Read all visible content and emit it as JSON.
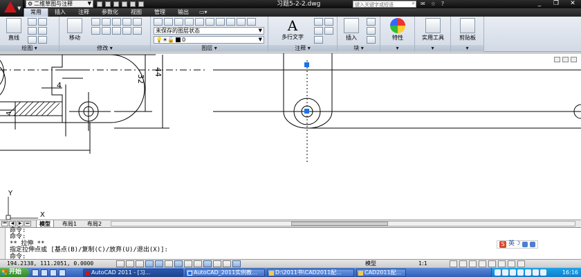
{
  "window": {
    "workspace": "二维草图与注释",
    "title": "习题5-2-2.dwg",
    "search_placeholder": "键入关键字或短语"
  },
  "ribbon": {
    "tabs": [
      "常用",
      "插入",
      "注释",
      "参数化",
      "视图",
      "管理",
      "输出"
    ],
    "buttons": {
      "line": "直线",
      "move": "移动",
      "multiline_text": "多行文字",
      "insert": "插入",
      "properties": "特性",
      "utilities": "实用工具",
      "clipboard": "剪贴板"
    },
    "layer": {
      "state": "未保存的图层状态",
      "current": "0"
    },
    "panels": {
      "draw": "绘图",
      "modify": "修改",
      "layers": "图层",
      "annotation": "注释",
      "block": "块"
    }
  },
  "drawing": {
    "dimensions": [
      "32",
      "44",
      "4",
      "4"
    ],
    "ucs_x": "X",
    "ucs_y": "Y"
  },
  "layout_tabs": [
    "模型",
    "布局1",
    "布局2"
  ],
  "command": {
    "lines": [
      "命令:",
      "命令:",
      "** 拉伸 **",
      "指定拉伸点或 [基点(B)/复制(C)/放弃(U)/退出(X)]:",
      "命令:"
    ]
  },
  "ime": {
    "label": "英"
  },
  "status": {
    "coords": "194.2138, 111.2051, 0.0000",
    "model": "模型",
    "scale": "1:1"
  },
  "taskbar": {
    "start": "开始",
    "tasks": [
      "AutoCAD 2011 - [习...",
      "AutoCAD_2011实例教...",
      "D:\\2011书\\CAD2011配...",
      "CAD2011配..."
    ],
    "time": "16:16"
  },
  "colors": {
    "grip_blue": "#1a73e8",
    "cad_red": "#c8161d",
    "ribbon_bg": "#dfe5ee"
  }
}
